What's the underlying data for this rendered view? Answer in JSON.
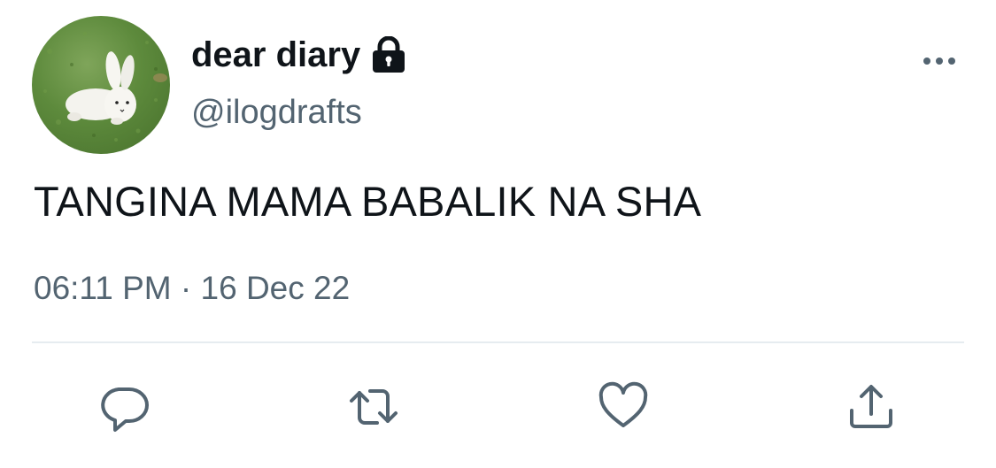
{
  "tweet": {
    "display_name": "dear diary",
    "handle": "@ilogdrafts",
    "text": "TANGINA MAMA BABALIK NA SHA",
    "timestamp": "06:11 PM · 16 Dec 22",
    "protected_icon": "lock-icon",
    "avatar": "white bunny figure on grass"
  },
  "actions": [
    {
      "name": "reply",
      "icon": "speech-bubble-icon"
    },
    {
      "name": "retweet",
      "icon": "retweet-arrows-icon"
    },
    {
      "name": "like",
      "icon": "heart-icon"
    },
    {
      "name": "share",
      "icon": "share-upload-icon"
    }
  ],
  "colors": {
    "text": "#0f1419",
    "secondary": "#536471",
    "icon": "#536471",
    "divider": "#e6ecf0",
    "background": "#ffffff"
  }
}
